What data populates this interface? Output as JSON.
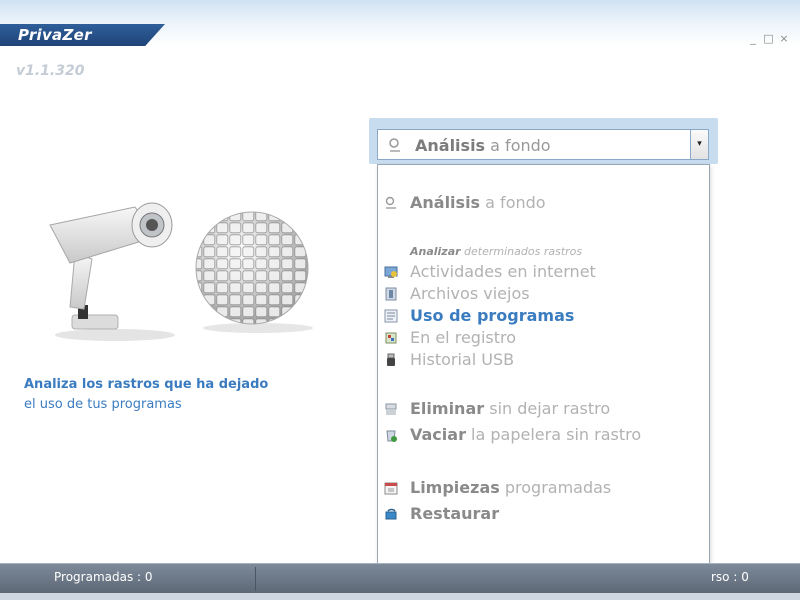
{
  "app": {
    "logo_text": "PrivaZer",
    "version": "v1.1.320",
    "window_controls": [
      "_",
      "□",
      "×"
    ]
  },
  "promo": {
    "title": "Analiza los rastros que ha dejado",
    "subtitle": "el uso de tus programas"
  },
  "mode_select": {
    "selected_bold": "Análisis",
    "selected_rest": " a fondo",
    "arrow": "▾"
  },
  "dropdown": {
    "deep_scan": {
      "bold": "Análisis",
      "rest": " a fondo",
      "icon": "scan-icon"
    },
    "section_header": {
      "bold": "Analizar",
      "rest": " determinados rastros"
    },
    "items": [
      {
        "label": "Actividades en internet",
        "icon": "internet-icon",
        "active": false
      },
      {
        "label": "Archivos viejos",
        "icon": "old-files-icon",
        "active": false
      },
      {
        "label": "Uso de programas",
        "icon": "programs-icon",
        "active": true
      },
      {
        "label": "En el registro",
        "icon": "registry-icon",
        "active": false
      },
      {
        "label": "Historial USB",
        "icon": "usb-icon",
        "active": false
      }
    ],
    "delete": {
      "bold": "Eliminar",
      "rest": " sin dejar rastro",
      "icon": "shredder-icon"
    },
    "recycle": {
      "bold": "Vaciar",
      "rest": " la papelera sin rastro",
      "icon": "recycle-bin-icon"
    },
    "scheduled": {
      "bold": "Limpiezas",
      "rest": " programadas",
      "icon": "calendar-icon"
    },
    "restore": {
      "bold": "Restaurar",
      "rest": "",
      "icon": "restore-icon"
    }
  },
  "statusbar": {
    "left": "Programadas : 0",
    "right": "rso : 0"
  },
  "colors": {
    "accent": "#3b7cc0",
    "title_bar": "#2f5f9a",
    "status_bar": "#6b7785"
  }
}
